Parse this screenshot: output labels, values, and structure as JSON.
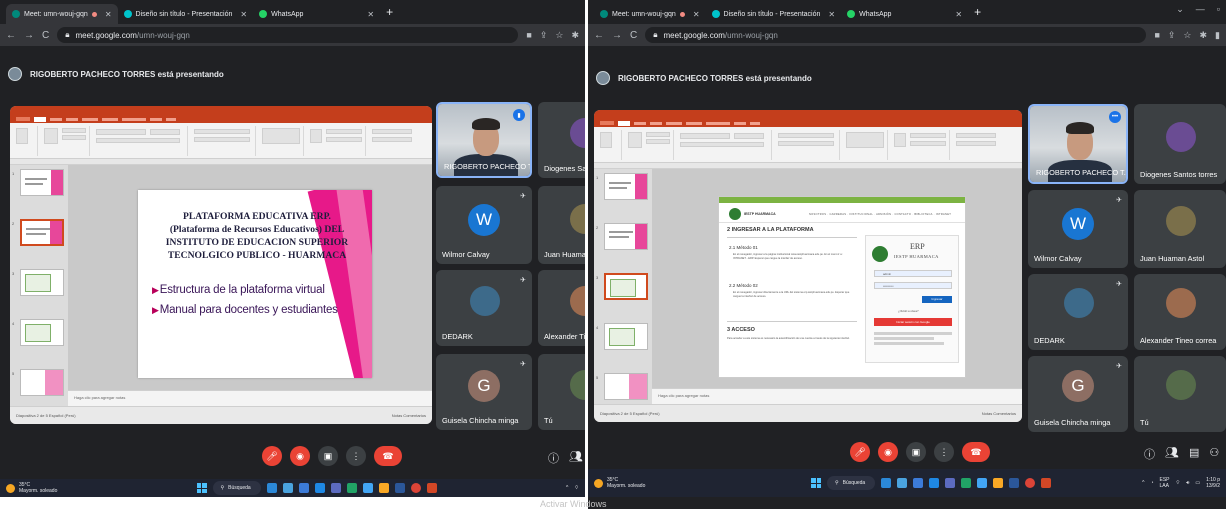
{
  "browser": {
    "tabs": [
      {
        "label": "Meet: umn-wouj-gqn",
        "icon_color": "#00897b",
        "recording": true
      },
      {
        "label": "Diseño sin título - Presentación",
        "icon_color": "#00c4cc",
        "recording": false
      },
      {
        "label": "WhatsApp",
        "icon_color": "#25d366",
        "recording": false
      }
    ],
    "url_host": "meet.google.com",
    "url_path": "/umn-wouj-gqn"
  },
  "meet": {
    "presenting_banner": "RIGOBERTO PACHECO TORRES está presentando"
  },
  "participants_left": [
    {
      "name": "RIGOBERTO PACHECO T...",
      "type": "camera",
      "speaking": true
    },
    {
      "name": "Diogenes Sant",
      "type": "photo",
      "avatar_color": "#6a4c93"
    },
    {
      "name": "Wilmor Calvay",
      "type": "letter",
      "letter": "W",
      "avatar_color": "#1976d2"
    },
    {
      "name": "Juan Huaman",
      "type": "photo",
      "avatar_color": "#7a6f4a"
    },
    {
      "name": "DEDARK",
      "type": "photo",
      "avatar_color": "#3d6a8a"
    },
    {
      "name": "Alexander Tin",
      "type": "photo",
      "avatar_color": "#9c6b4e"
    },
    {
      "name": "Guisela Chincha minga",
      "type": "letter",
      "letter": "G",
      "avatar_color": "#8d6e63"
    },
    {
      "name": "Tú",
      "type": "photo",
      "avatar_color": "#556b4a"
    }
  ],
  "participants_right": [
    {
      "name": "RIGOBERTO PACHECO T...",
      "type": "camera",
      "speaking": true
    },
    {
      "name": "Diogenes Santos torres",
      "type": "photo",
      "avatar_color": "#6a4c93"
    },
    {
      "name": "Wilmor Calvay",
      "type": "letter",
      "letter": "W",
      "avatar_color": "#1976d2"
    },
    {
      "name": "Juan Huaman Astol",
      "type": "photo",
      "avatar_color": "#7a6f4a"
    },
    {
      "name": "DEDARK",
      "type": "photo",
      "avatar_color": "#3d6a8a"
    },
    {
      "name": "Alexander Tineo correa",
      "type": "photo",
      "avatar_color": "#9c6b4e"
    },
    {
      "name": "Guisela Chincha minga",
      "type": "letter",
      "letter": "G",
      "avatar_color": "#8d6e63"
    },
    {
      "name": "Tú",
      "type": "photo",
      "avatar_color": "#556b4a"
    }
  ],
  "slide_left": {
    "title": "PLATAFORMA EDUCATIVA ERP. (Plataforma de Recursos Educativos) DEL INSTITUTO DE EDUCACION SUPERIOR TECNOLGICO PUBLICO - HUARMACA",
    "bullets": [
      "Estructura de la plataforma virtual",
      "Manual para docentes y estudiantes"
    ]
  },
  "slide_right": {
    "site_name": "IESTP HUARMACA",
    "nav_links": "NOSOTROS · CARRERAS · INSTITUCIONAL · ADMISIÓN · CONTACTO · BIBLIOTECA · INTRANET",
    "section_title": "2  INGRESAR A LA PLATAFORMA",
    "step1_title": "2.1  Método 01",
    "step1_text": "En el navegador, ingresar a la página institucional www.iestphuarmaca.edu.pe. En el menú ir a: INTRANET - ERP. Esperar que cargue la interfaz de acceso.",
    "step2_title": "2.2  Método 02",
    "step2_text": "En el navegador, ingresar directamente a la URL del sistema erp.iestphuarmaca.edu.pe. Esperar que cargue la interfaz de acceso.",
    "section3_title": "3  ACCESO",
    "section3_text": "Para acceder a este sistema es necesario la autentificación de una cuenta a través de la siguiente interfaz.",
    "login_title": "ERP",
    "login_subtitle": "IESTP HUARMACA",
    "login_user": "admin",
    "login_pass": "••••••••••",
    "login_button": "Ingresar",
    "login_forgot": "¿Olvidó su clave?",
    "login_alt": "Iniciar sesión con Google"
  },
  "ppt": {
    "notes_placeholder": "Haga clic para agregar notas",
    "status_left": "Diapositiva 2 de 5   Español (Perú)",
    "status_right": "Notas   Comentarios"
  },
  "taskbar": {
    "temp": "35°C",
    "weather": "Mayorm. soleado",
    "search": "Búsqueda",
    "lang": "ESP",
    "lang2": "LAA",
    "time": "1:10 p",
    "date": "13/9/2"
  },
  "watermark": "Activar Windows"
}
